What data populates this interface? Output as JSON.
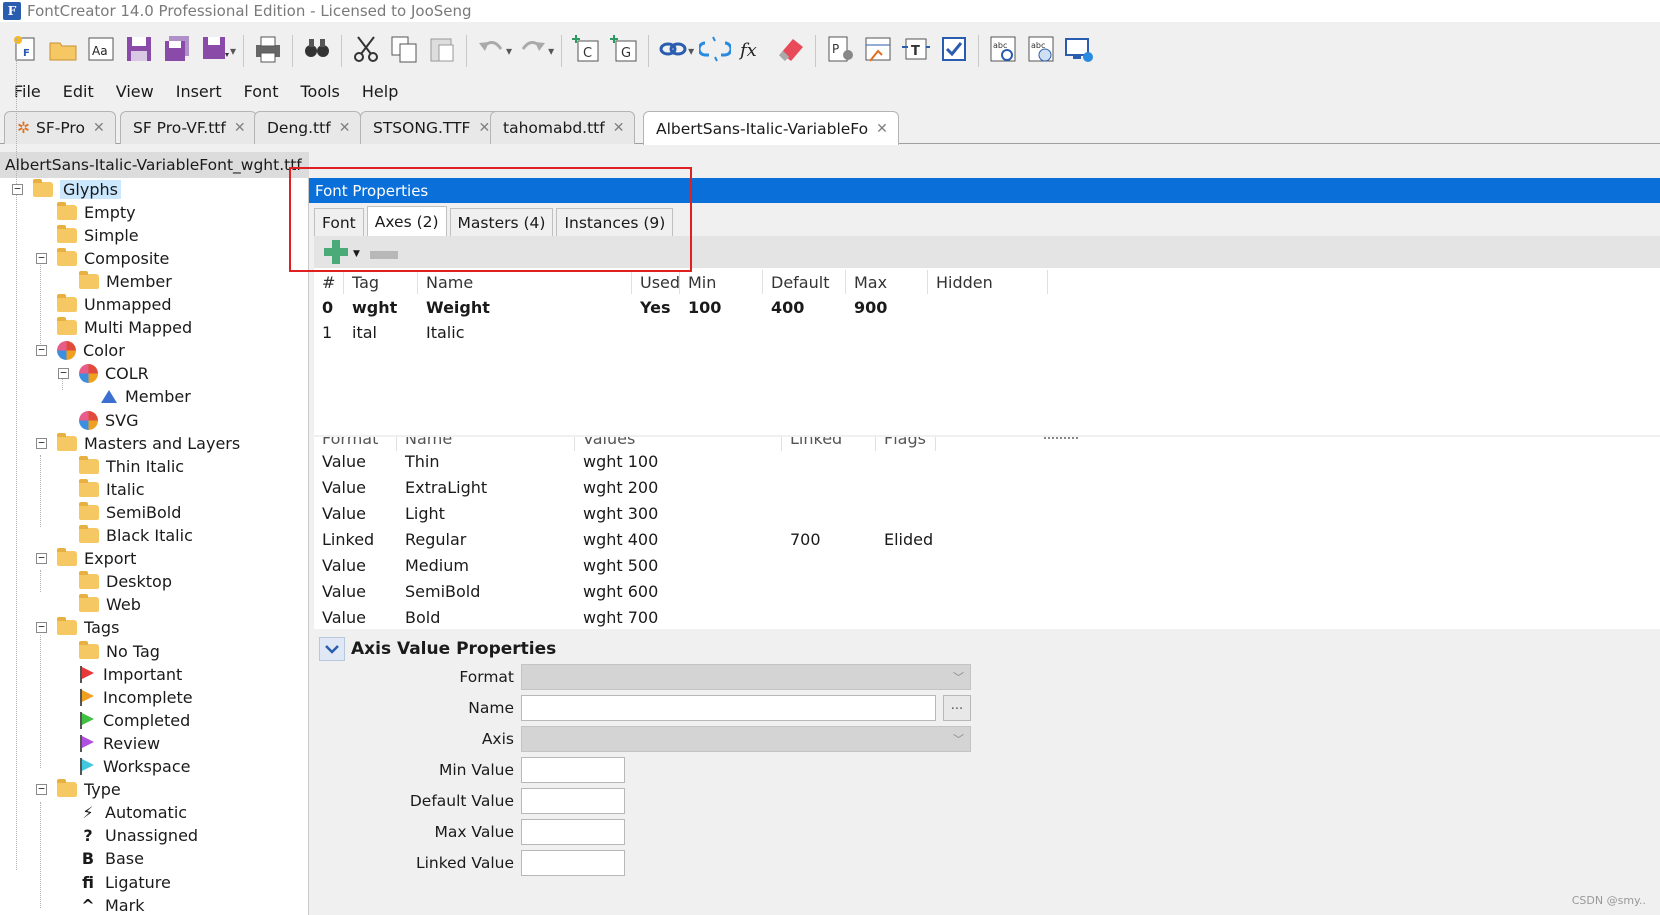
{
  "app": {
    "title": "FontCreator 14.0 Professional Edition - Licensed to JooSeng",
    "icon_letter": "F"
  },
  "toolbar": {
    "icons": [
      "new-font-icon",
      "open-icon",
      "font-preview-icon",
      "save-icon",
      "save-all-icon",
      "save-as-icon",
      "print-icon",
      "find-icon",
      "cut-icon",
      "copy-icon",
      "paste-icon",
      "undo-icon",
      "redo-icon",
      "add-character-icon",
      "add-glyph-icon",
      "link-icon",
      "unlink-icon",
      "formula-icon",
      "eraser-icon",
      "properties-icon",
      "metrics-icon",
      "transform-icon",
      "validate-icon",
      "spell-check-icon",
      "web-spell-icon",
      "test-install-icon"
    ]
  },
  "menu": [
    "File",
    "Edit",
    "View",
    "Insert",
    "Font",
    "Tools",
    "Help"
  ],
  "doc_tabs": [
    {
      "label": "SF-Pro",
      "active": false,
      "icon": "gear"
    },
    {
      "label": "SF Pro-VF.ttf",
      "active": false
    },
    {
      "label": "Deng.ttf",
      "active": false
    },
    {
      "label": "STSONG.TTF",
      "active": false
    },
    {
      "label": "tahomabd.ttf",
      "active": false
    },
    {
      "label": "AlbertSans-Italic-VariableFo",
      "active": true
    }
  ],
  "tab_close": "✕",
  "file_name": "AlbertSans-Italic-VariableFont_wght.ttf",
  "tree": [
    {
      "label": "Glyphs",
      "level": 0,
      "icon": "folder",
      "toggle": "−",
      "selected": true
    },
    {
      "label": "Empty",
      "level": 1,
      "icon": "folder"
    },
    {
      "label": "Simple",
      "level": 1,
      "icon": "folder"
    },
    {
      "label": "Composite",
      "level": 1,
      "icon": "folder",
      "toggle": "−"
    },
    {
      "label": "Member",
      "level": 2,
      "icon": "folder"
    },
    {
      "label": "Unmapped",
      "level": 1,
      "icon": "folder"
    },
    {
      "label": "Multi Mapped",
      "level": 1,
      "icon": "folder"
    },
    {
      "label": "Color",
      "level": 1,
      "icon": "pie",
      "toggle": "−"
    },
    {
      "label": "COLR",
      "level": 2,
      "icon": "pie",
      "toggle": "−"
    },
    {
      "label": "Member",
      "level": 3,
      "icon": "triangle"
    },
    {
      "label": "SVG",
      "level": 2,
      "icon": "pie"
    },
    {
      "label": "Masters and Layers",
      "level": 1,
      "icon": "folder",
      "toggle": "−"
    },
    {
      "label": "Thin Italic",
      "level": 2,
      "icon": "folder"
    },
    {
      "label": "Italic",
      "level": 2,
      "icon": "folder"
    },
    {
      "label": "SemiBold",
      "level": 2,
      "icon": "folder"
    },
    {
      "label": "Black Italic",
      "level": 2,
      "icon": "folder"
    },
    {
      "label": "Export",
      "level": 1,
      "icon": "folder",
      "toggle": "−"
    },
    {
      "label": "Desktop",
      "level": 2,
      "icon": "folder"
    },
    {
      "label": "Web",
      "level": 2,
      "icon": "folder"
    },
    {
      "label": "Tags",
      "level": 1,
      "icon": "folder",
      "toggle": "−"
    },
    {
      "label": "No Tag",
      "level": 2,
      "icon": "folder"
    },
    {
      "label": "Important",
      "level": 2,
      "icon": "flag",
      "color": "#e83838"
    },
    {
      "label": "Incomplete",
      "level": 2,
      "icon": "flag",
      "color": "#f0a020"
    },
    {
      "label": "Completed",
      "level": 2,
      "icon": "flag",
      "color": "#40c040"
    },
    {
      "label": "Review",
      "level": 2,
      "icon": "flag",
      "color": "#b050e0"
    },
    {
      "label": "Workspace",
      "level": 2,
      "icon": "flag",
      "color": "#40c8e0"
    },
    {
      "label": "Type",
      "level": 1,
      "icon": "folder",
      "toggle": "−"
    },
    {
      "label": "Automatic",
      "level": 2,
      "icon": "glyph",
      "glyph": "⚡"
    },
    {
      "label": "Unassigned",
      "level": 2,
      "icon": "glyph",
      "glyph": "?"
    },
    {
      "label": "Base",
      "level": 2,
      "icon": "glyph",
      "glyph": "B"
    },
    {
      "label": "Ligature",
      "level": 2,
      "icon": "glyph",
      "glyph": "fi"
    },
    {
      "label": "Mark",
      "level": 2,
      "icon": "glyph",
      "glyph": "^"
    }
  ],
  "panel": {
    "title": "Font Properties",
    "tabs": [
      "Font",
      "Axes (2)",
      "Masters (4)",
      "Instances (9)"
    ],
    "active_tab": 1
  },
  "axes": {
    "headers": [
      "#",
      "Tag",
      "Name",
      "Used",
      "Min",
      "Default",
      "Max",
      "Hidden"
    ],
    "rows": [
      {
        "cells": [
          "0",
          "wght",
          "Weight",
          "Yes",
          "100",
          "400",
          "900",
          ""
        ],
        "bold": true
      },
      {
        "cells": [
          "1",
          "ital",
          "Italic",
          "",
          "",
          "",
          "",
          ""
        ],
        "bold": false
      }
    ]
  },
  "axis_values": {
    "headers": [
      "Format",
      "Name",
      "Values",
      "Linked",
      "Flags"
    ],
    "rows": [
      [
        "Value",
        "Thin",
        "wght 100",
        "",
        ""
      ],
      [
        "Value",
        "ExtraLight",
        "wght 200",
        "",
        ""
      ],
      [
        "Value",
        "Light",
        "wght 300",
        "",
        ""
      ],
      [
        "Linked",
        "Regular",
        "wght 400",
        "700",
        "Elided"
      ],
      [
        "Value",
        "Medium",
        "wght 500",
        "",
        ""
      ],
      [
        "Value",
        "SemiBold",
        "wght 600",
        "",
        ""
      ],
      [
        "Value",
        "Bold",
        "wght 700",
        "",
        ""
      ]
    ]
  },
  "axis_value_properties": {
    "title": "Axis Value Properties",
    "fields": {
      "format": "Format",
      "name": "Name",
      "axis": "Axis",
      "min": "Min Value",
      "default": "Default Value",
      "max": "Max Value",
      "linked": "Linked Value"
    },
    "browse_label": "..."
  },
  "watermark": "CSDN @smy..",
  "colors": {
    "accent": "#0a6fd8",
    "highlight_box": "#e02020",
    "selection": "#cce8ff"
  }
}
